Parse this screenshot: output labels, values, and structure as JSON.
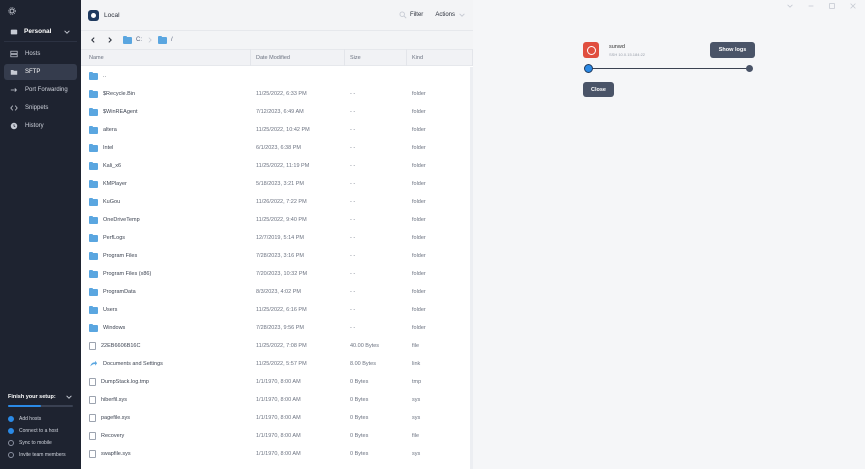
{
  "sidebar": {
    "personal_label": "Personal",
    "nav": [
      {
        "label": "Hosts",
        "icon": "hosts-icon"
      },
      {
        "label": "SFTP",
        "icon": "sftp-icon",
        "active": true
      },
      {
        "label": "Port Forwarding",
        "icon": "port-forwarding-icon"
      },
      {
        "label": "Snippets",
        "icon": "snippets-icon"
      },
      {
        "label": "History",
        "icon": "history-icon"
      }
    ],
    "setup": {
      "title": "Finish your setup:",
      "progress": 0.5,
      "steps": [
        {
          "label": "Add hosts",
          "done": true
        },
        {
          "label": "Connect to a host",
          "done": true
        },
        {
          "label": "Sync to mobile",
          "done": false
        },
        {
          "label": "Invite team members",
          "done": false
        }
      ]
    }
  },
  "pane": {
    "title": "Local",
    "filter_label": "Filter",
    "actions_label": "Actions",
    "path": {
      "drive": "C:",
      "sep": "/"
    },
    "columns": {
      "name": "Name",
      "date": "Date Modified",
      "size": "Size",
      "kind": "Kind"
    },
    "files": [
      {
        "name": "..",
        "date": "",
        "size": "",
        "kind": "",
        "type": "folder"
      },
      {
        "name": "$Recycle.Bin",
        "date": "11/25/2022, 6:33 PM",
        "size": "- -",
        "kind": "folder",
        "type": "folder"
      },
      {
        "name": "$WinREAgent",
        "date": "7/12/2023, 6:49 AM",
        "size": "- -",
        "kind": "folder",
        "type": "folder"
      },
      {
        "name": "altera",
        "date": "11/25/2022, 10:42 PM",
        "size": "- -",
        "kind": "folder",
        "type": "folder"
      },
      {
        "name": "Intel",
        "date": "6/1/2023, 6:38 PM",
        "size": "- -",
        "kind": "folder",
        "type": "folder"
      },
      {
        "name": "Kali_x6",
        "date": "11/25/2022, 11:19 PM",
        "size": "- -",
        "kind": "folder",
        "type": "folder"
      },
      {
        "name": "KMPlayer",
        "date": "5/18/2023, 3:21 PM",
        "size": "- -",
        "kind": "folder",
        "type": "folder"
      },
      {
        "name": "KuGou",
        "date": "11/26/2022, 7:22 PM",
        "size": "- -",
        "kind": "folder",
        "type": "folder"
      },
      {
        "name": "OneDriveTemp",
        "date": "11/25/2022, 9:40 PM",
        "size": "- -",
        "kind": "folder",
        "type": "folder"
      },
      {
        "name": "PerfLogs",
        "date": "12/7/2019, 5:14 PM",
        "size": "- -",
        "kind": "folder",
        "type": "folder"
      },
      {
        "name": "Program Files",
        "date": "7/28/2023, 3:16 PM",
        "size": "- -",
        "kind": "folder",
        "type": "folder"
      },
      {
        "name": "Program Files (x86)",
        "date": "7/20/2023, 10:32 PM",
        "size": "- -",
        "kind": "folder",
        "type": "folder"
      },
      {
        "name": "ProgramData",
        "date": "8/3/2023, 4:02 PM",
        "size": "- -",
        "kind": "folder",
        "type": "folder"
      },
      {
        "name": "Users",
        "date": "11/25/2022, 6:16 PM",
        "size": "- -",
        "kind": "folder",
        "type": "folder"
      },
      {
        "name": "Windows",
        "date": "7/28/2023, 9:56 PM",
        "size": "- -",
        "kind": "folder",
        "type": "folder"
      },
      {
        "name": "22EB6606B16C",
        "date": "11/25/2022, 7:08 PM",
        "size": "40.00 Bytes",
        "kind": "file",
        "type": "file"
      },
      {
        "name": "Documents and Settings",
        "date": "11/25/2022, 5:57 PM",
        "size": "8.00 Bytes",
        "kind": "link",
        "type": "link"
      },
      {
        "name": "DumpStack.log.tmp",
        "date": "1/1/1970, 8:00 AM",
        "size": "0 Bytes",
        "kind": "tmp",
        "type": "file"
      },
      {
        "name": "hiberfil.sys",
        "date": "1/1/1970, 8:00 AM",
        "size": "0 Bytes",
        "kind": "sys",
        "type": "file"
      },
      {
        "name": "pagefile.sys",
        "date": "1/1/1970, 8:00 AM",
        "size": "0 Bytes",
        "kind": "sys",
        "type": "file"
      },
      {
        "name": "Recovery",
        "date": "1/1/1970, 8:00 AM",
        "size": "0 Bytes",
        "kind": "file",
        "type": "file"
      },
      {
        "name": "swapfile.sys",
        "date": "1/1/1970, 8:00 AM",
        "size": "0 Bytes",
        "kind": "sys",
        "type": "file"
      }
    ]
  },
  "connection": {
    "host_name": "sunwd",
    "host_sub": "SSH 10.0.15.184:22",
    "show_logs_label": "Show logs",
    "close_label": "Close"
  },
  "colors": {
    "accent": "#2b8ae6",
    "sidebar_bg": "#1e2330",
    "folder": "#5aa6e0",
    "host": "#e04e3f"
  }
}
